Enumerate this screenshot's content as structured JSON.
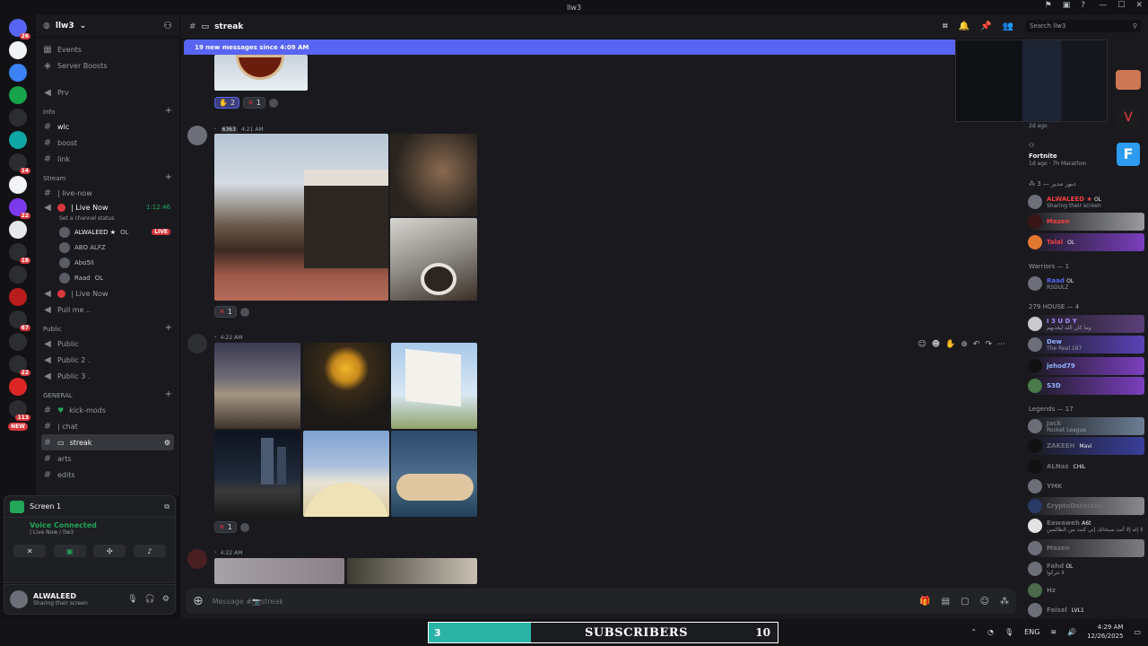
{
  "window": {
    "title": "llw3"
  },
  "server": {
    "name": "llw3"
  },
  "channels_top": [
    {
      "icon": "calendar-icon",
      "label": "Events"
    },
    {
      "icon": "boost-icon",
      "label": "Server Boosts"
    },
    {
      "icon": "speaker-icon",
      "label": "Prv"
    }
  ],
  "categories": {
    "info": "Info",
    "stream": "Stream",
    "public": "Public",
    "general": "GENERAL"
  },
  "info_channels": [
    "wlc",
    "boost",
    "link"
  ],
  "stream_channels": {
    "live_now_text": "| live-now",
    "voice": "| Live Now",
    "timer": "1:12:46",
    "status": "Set a channel status",
    "users": [
      {
        "name": "ALWALEED ★",
        "tag": "OL",
        "live": "LIVE"
      },
      {
        "name": "ABO ALFZ"
      },
      {
        "name": "Abo5li"
      },
      {
        "name": "Raad",
        "tag": "OL"
      }
    ],
    "voice2": "| Live Now",
    "pull": "Pull me .."
  },
  "public_channels": [
    "Public",
    "Public 2 .",
    "Public 3 ."
  ],
  "general_channels": [
    "kick-mods",
    "| chat",
    "streak",
    "arts",
    "edits"
  ],
  "voice_panel": {
    "screen_label": "Screen 1",
    "connected": "Voice Connected",
    "location": "| Live Now / llw3"
  },
  "user_panel": {
    "name": "ALWALEED",
    "status": "Sharing their screen"
  },
  "rail_badges": [
    "26",
    "14",
    "22",
    "18",
    "67",
    "22",
    "113",
    "2"
  ],
  "rail_new": "NEW",
  "header": {
    "channel": "streak"
  },
  "new_messages": "19 new messages since 4:09 AM",
  "messages": [
    {
      "time": "4:21 AM",
      "tag": "6363",
      "reactions": [
        {
          "emoji": "✋",
          "count": "2"
        },
        {
          "emoji": "✕",
          "count": "1"
        }
      ]
    },
    {
      "time": "4:22 AM",
      "reactions": [
        {
          "emoji": "✕",
          "count": "1"
        }
      ]
    },
    {
      "time": "4:22 AM",
      "reactions": [
        {
          "emoji": "✕",
          "count": "1"
        }
      ]
    },
    {
      "time": "4:22 AM"
    }
  ],
  "first_reactions": [
    {
      "emoji": "✋",
      "count": "2"
    },
    {
      "emoji": "✕",
      "count": "1"
    }
  ],
  "composer": {
    "placeholder": "Message #📷streak"
  },
  "search": {
    "placeholder": "Search llw3"
  },
  "sidebar": {
    "activity": {
      "game": "Fortnite",
      "time": "1d ago",
      "mode": "7h Marathon",
      "ago": "2d ago"
    },
    "group1": "⁂ 3 — دبور مدير",
    "members1": [
      {
        "name": "ALWALEED ★",
        "tag": "OL",
        "sub": "Sharing their screen",
        "color": "#f23f43"
      },
      {
        "name": "Mazen",
        "color": "#f23f43"
      },
      {
        "name": "Talal",
        "tag": "OL",
        "color": "#f23f43"
      }
    ],
    "group2": "Warriors — 1",
    "members2": [
      {
        "name": "Raad",
        "tag": "OL",
        "sub": "RSDULZ",
        "color": "#5865f2"
      }
    ],
    "group3": "279 HOUSE — 4",
    "members3": [
      {
        "name": "I 3 U D Y",
        "sub": "وما كان الله ليعذبهم",
        "color": "#a78bfa"
      },
      {
        "name": "Dew",
        "sub": "The Real 187",
        "color": "#8fb3ff"
      },
      {
        "name": "jehod79",
        "color": "#8fb3ff"
      },
      {
        "name": "S3D",
        "color": "#8fb3ff"
      }
    ],
    "group4": "Legends — 17",
    "members4": [
      {
        "name": "Jack",
        "sub": "Rocket League"
      },
      {
        "name": "ZAKEEH",
        "tag": "Mavi"
      },
      {
        "name": "ALNaz",
        "tag": "CHIL"
      },
      {
        "name": "YMK"
      },
      {
        "name": "CryptoDetected"
      },
      {
        "name": "Eawaweh",
        "tag": "A6t",
        "sub": "لا إله إلا أنت سبحانك إني كنت من الظالمين"
      },
      {
        "name": "Mazen"
      },
      {
        "name": "Fahd",
        "tag": "OL",
        "sub": "لا تتركوا"
      },
      {
        "name": "Hz"
      },
      {
        "name": "Faisal",
        "tag": "LVL1"
      }
    ]
  },
  "taskbar": {
    "sub_left": "3",
    "sub_label": "SUBSCRIBERS",
    "sub_right": "10",
    "lang": "ENG",
    "time": "4:29 AM",
    "date": "12/26/2025"
  }
}
